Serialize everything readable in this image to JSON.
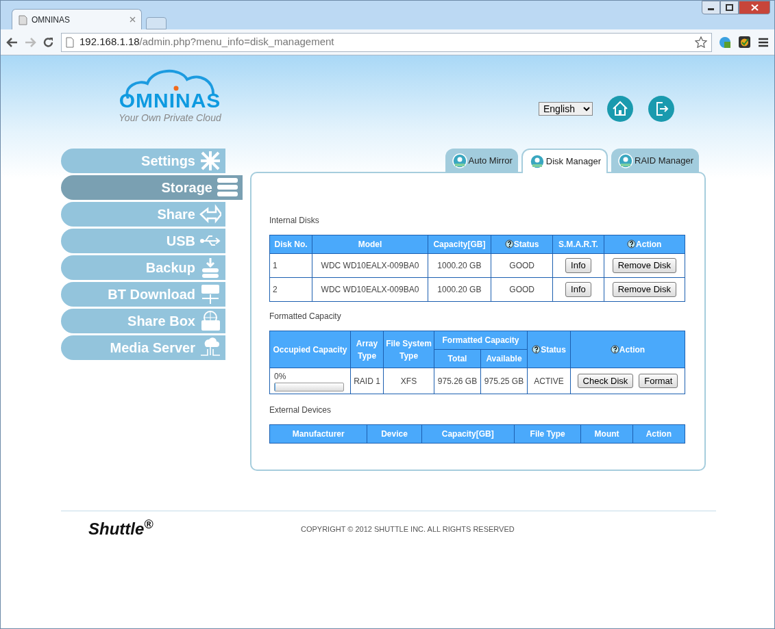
{
  "browser": {
    "tab_title": "OMNINAS",
    "url_host": "192.168.1.18",
    "url_path": "/admin.php?menu_info=disk_management"
  },
  "logo": {
    "name": "OMNINAS",
    "tagline": "Your Own Private Cloud"
  },
  "language": {
    "value": "English"
  },
  "sidebar": [
    {
      "label": "Settings",
      "selected": false
    },
    {
      "label": "Storage",
      "selected": true
    },
    {
      "label": "Share",
      "selected": false
    },
    {
      "label": "USB",
      "selected": false
    },
    {
      "label": "Backup",
      "selected": false
    },
    {
      "label": "BT Download",
      "selected": false
    },
    {
      "label": "Share Box",
      "selected": false
    },
    {
      "label": "Media Server",
      "selected": false
    }
  ],
  "tabs": [
    {
      "label": "Auto Mirror",
      "selected": false
    },
    {
      "label": "Disk Manager",
      "selected": true
    },
    {
      "label": "RAID Manager",
      "selected": false
    }
  ],
  "internal_disks": {
    "title": "Internal Disks",
    "columns": [
      {
        "label": "Disk No.",
        "help": false
      },
      {
        "label": "Model",
        "help": false
      },
      {
        "label": "Capacity[GB]",
        "help": false
      },
      {
        "label": "Status",
        "help": true
      },
      {
        "label": "S.M.A.R.T.",
        "help": false
      },
      {
        "label": "Action",
        "help": true
      }
    ],
    "rows": [
      {
        "disk_no": "1",
        "model": "WDC WD10EALX-009BA0",
        "capacity": "1000.20 GB",
        "status": "GOOD",
        "smart_button": "Info",
        "action_button": "Remove Disk"
      },
      {
        "disk_no": "2",
        "model": "WDC WD10EALX-009BA0",
        "capacity": "1000.20 GB",
        "status": "GOOD",
        "smart_button": "Info",
        "action_button": "Remove Disk"
      }
    ]
  },
  "formatted_capacity": {
    "title": "Formatted Capacity",
    "columns": {
      "occupied": "Occupied Capacity",
      "array_type": "Array Type",
      "file_system": "File System Type",
      "formatted": "Formatted Capacity",
      "total": "Total",
      "available": "Available",
      "status": "Status",
      "action": "Action"
    },
    "rows": [
      {
        "occupied": "0%",
        "level": 0,
        "array_type": "RAID 1",
        "file_system": "XFS",
        "total": "975.26 GB",
        "available": "975.25 GB",
        "status": "ACTIVE",
        "buttons": [
          "Check Disk",
          "Format"
        ]
      }
    ]
  },
  "external_devices": {
    "title": "External Devices",
    "columns": [
      "Manufacturer",
      "Device",
      "Capacity[GB]",
      "File Type",
      "Mount",
      "Action"
    ]
  },
  "footer": {
    "brand": "Shuttle$^{®}$",
    "copyright": "COPYRIGHT © 2012 SHUTTLE INC. ALL RIGHTS RESERVED"
  }
}
